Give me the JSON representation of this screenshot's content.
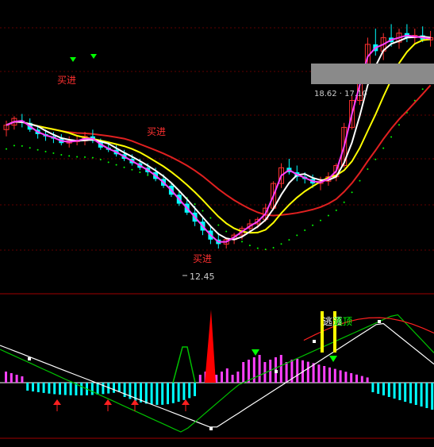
{
  "chart_data": [
    {
      "type": "candlestick",
      "title": "",
      "price_tooltip": "18.62 · 17.10",
      "low_marker": "12.45",
      "signals": [
        {
          "text": "买进",
          "kind": "buy"
        },
        {
          "text": "买进",
          "kind": "buy"
        },
        {
          "text": "买进",
          "kind": "buy"
        }
      ],
      "colors": {
        "up": "#ff3030",
        "down": "#00ffff",
        "bull_body": "#00ff00",
        "line_white": "#ffffff",
        "line_yellow": "#ffff00",
        "line_magenta": "#ff40ff",
        "line_red": "#e02020",
        "line_dots": "#00ff00"
      },
      "candles": [
        [
          0,
          13.9,
          14.3,
          13.6,
          14.1
        ],
        [
          1,
          14.1,
          14.5,
          13.9,
          14.4
        ],
        [
          2,
          14.3,
          14.6,
          14.0,
          14.2
        ],
        [
          3,
          14.2,
          14.4,
          13.8,
          13.9
        ],
        [
          4,
          13.9,
          14.1,
          13.5,
          13.7
        ],
        [
          5,
          13.7,
          13.9,
          13.4,
          13.6
        ],
        [
          6,
          13.6,
          13.8,
          13.3,
          13.5
        ],
        [
          7,
          13.5,
          13.7,
          13.2,
          13.3
        ],
        [
          8,
          13.3,
          13.6,
          13.1,
          13.4
        ],
        [
          9,
          13.4,
          13.6,
          13.2,
          13.4
        ],
        [
          10,
          13.4,
          13.8,
          13.2,
          13.6
        ],
        [
          11,
          13.6,
          13.9,
          13.3,
          13.4
        ],
        [
          12,
          13.4,
          13.5,
          13.0,
          13.1
        ],
        [
          13,
          13.1,
          13.3,
          12.9,
          13.0
        ],
        [
          14,
          13.0,
          13.2,
          12.7,
          12.8
        ],
        [
          15,
          12.8,
          13.0,
          12.5,
          12.6
        ],
        [
          16,
          12.6,
          12.8,
          12.3,
          12.4
        ],
        [
          17,
          12.4,
          12.6,
          12.1,
          12.2
        ],
        [
          18,
          12.2,
          12.4,
          11.9,
          12.0
        ],
        [
          19,
          12.0,
          12.2,
          11.6,
          11.7
        ],
        [
          20,
          11.7,
          11.9,
          11.3,
          11.4
        ],
        [
          21,
          11.4,
          11.5,
          10.9,
          11.0
        ],
        [
          22,
          11.0,
          11.1,
          10.5,
          10.6
        ],
        [
          23,
          10.6,
          10.8,
          10.1,
          10.2
        ],
        [
          24,
          10.2,
          10.5,
          9.6,
          9.8
        ],
        [
          25,
          9.8,
          10.0,
          9.2,
          9.4
        ],
        [
          26,
          9.4,
          9.6,
          8.8,
          9.0
        ],
        [
          27,
          9.0,
          9.3,
          8.6,
          8.8
        ],
        [
          28,
          8.8,
          9.1,
          8.6,
          9.0
        ],
        [
          29,
          9.0,
          9.3,
          8.8,
          9.2
        ],
        [
          30,
          9.2,
          9.6,
          9.0,
          9.5
        ],
        [
          31,
          9.5,
          9.9,
          9.3,
          9.7
        ],
        [
          32,
          9.7,
          10.0,
          9.5,
          9.9
        ],
        [
          33,
          9.9,
          10.6,
          9.8,
          10.4
        ],
        [
          34,
          10.4,
          11.6,
          10.3,
          11.5
        ],
        [
          35,
          11.5,
          12.4,
          11.3,
          12.2
        ],
        [
          36,
          12.2,
          12.6,
          11.9,
          12.0
        ],
        [
          37,
          12.0,
          12.3,
          11.6,
          11.8
        ],
        [
          38,
          11.8,
          12.0,
          11.5,
          11.7
        ],
        [
          39,
          11.7,
          11.9,
          11.3,
          11.5
        ],
        [
          40,
          11.5,
          11.8,
          11.2,
          11.6
        ],
        [
          41,
          11.6,
          12.0,
          11.4,
          11.8
        ],
        [
          42,
          11.8,
          12.4,
          11.6,
          12.3
        ],
        [
          43,
          12.3,
          14.2,
          12.2,
          14.0
        ],
        [
          44,
          14.0,
          15.4,
          13.9,
          15.2
        ],
        [
          45,
          15.2,
          16.8,
          15.0,
          16.6
        ],
        [
          46,
          16.6,
          18.0,
          16.4,
          17.7
        ],
        [
          47,
          17.7,
          18.4,
          17.2,
          17.4
        ],
        [
          48,
          17.4,
          18.2,
          17.0,
          18.0
        ],
        [
          49,
          18.0,
          18.6,
          17.6,
          17.8
        ],
        [
          50,
          17.8,
          18.4,
          17.5,
          18.2
        ],
        [
          51,
          18.2,
          18.6,
          17.8,
          18.0
        ],
        [
          52,
          18.0,
          18.4,
          17.7,
          18.1
        ],
        [
          53,
          18.1,
          18.5,
          17.8,
          17.9
        ],
        [
          54,
          17.9,
          18.3,
          17.6,
          18.0
        ]
      ]
    },
    {
      "type": "bar",
      "title": "",
      "labels": [
        "逃顶",
        "逃顶"
      ],
      "colors": {
        "pos": "#ff40ff",
        "neg": "#00ffff",
        "line_white": "#ffffff",
        "line_green": "#00c000",
        "line_red": "#ff2020"
      }
    }
  ]
}
